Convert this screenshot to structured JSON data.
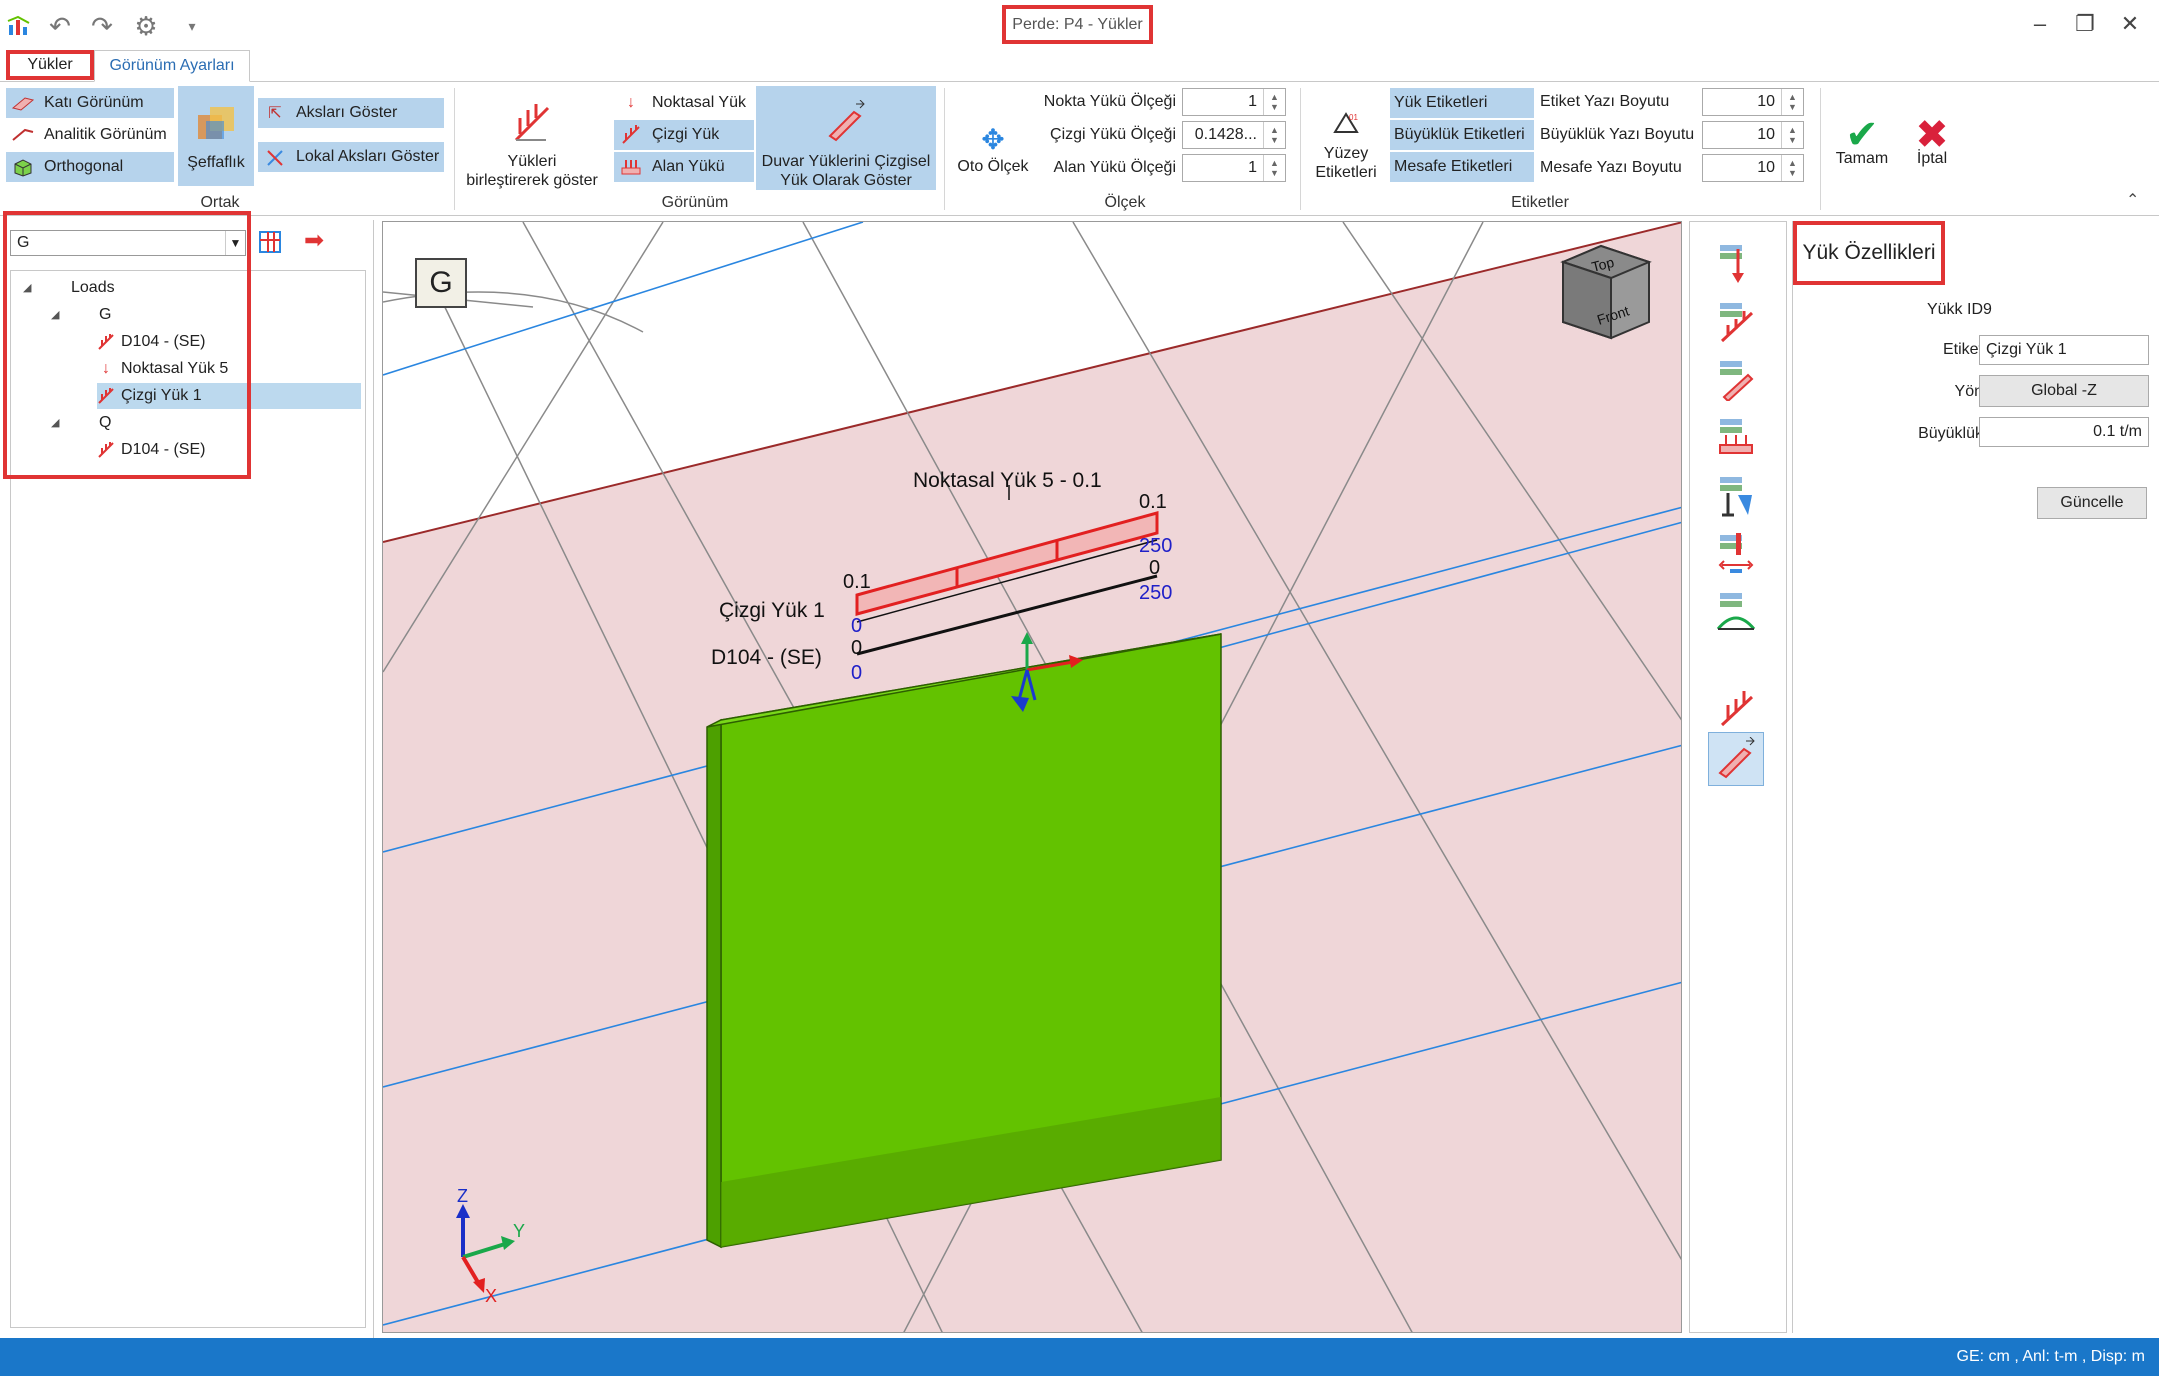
{
  "window": {
    "title": "Perde: P4 - Yükler",
    "minimize": "–",
    "restore": "❐",
    "close": "✕"
  },
  "quick_access": {
    "app_icon": "chart-icon",
    "undo": "↶",
    "redo": "↷",
    "settings": "⚙",
    "more": "▾"
  },
  "tabs": [
    "Yükler",
    "Görünüm Ayarları"
  ],
  "ribbon": {
    "ortak": {
      "label": "Ortak",
      "kati": "Katı Görünüm",
      "analitik": "Analitik Görünüm",
      "orthogonal": "Orthogonal",
      "seffaflik": "Şeffaflık",
      "akslari": "Aksları Göster",
      "lokal": "Lokal Aksları Göster"
    },
    "gorunum": {
      "label": "Görünüm",
      "birlestir": [
        "Yükleri",
        "birleştirerek göster"
      ],
      "noktasal": "Noktasal Yük",
      "cizgi": "Çizgi Yük",
      "alan": "Alan Yükü",
      "duvar": [
        "Duvar Yüklerini Çizgisel",
        "Yük Olarak Göster"
      ]
    },
    "olcek": {
      "label": "Ölçek",
      "oto": "Oto Ölçek",
      "nokta_lbl": "Nokta Yükü Ölçeği",
      "nokta_val": "1",
      "cizgi_lbl": "Çizgi Yükü Ölçeği",
      "cizgi_val": "0.1428...",
      "alan_lbl": "Alan Yükü Ölçeği",
      "alan_val": "1"
    },
    "etiketler": {
      "label": "Etiketler",
      "yuzey": [
        "Yüzey",
        "Etiketleri"
      ],
      "yuk_et": "Yük Etiketleri",
      "buyukluk_et": "Büyüklük Etiketleri",
      "mesafe_et": "Mesafe Etiketleri",
      "etiket_boyut_lbl": "Etiket Yazı Boyutu",
      "etiket_boyut_val": "10",
      "buyukluk_boyut_lbl": "Büyüklük Yazı Boyutu",
      "buyukluk_boyut_val": "10",
      "mesafe_boyut_lbl": "Mesafe Yazı Boyutu",
      "mesafe_boyut_val": "10"
    },
    "tamam": "Tamam",
    "iptal": "İptal"
  },
  "left": {
    "select_value": "G",
    "tree": {
      "root": "Loads",
      "g": "G",
      "g_items": [
        "D104 - (SE)",
        "Noktasal Yük 5",
        "Çizgi Yük 1"
      ],
      "q": "Q",
      "q_items": [
        "D104 - (SE)"
      ]
    }
  },
  "viewport": {
    "case_label": "G",
    "cube_top": "Top",
    "cube_front": "Front",
    "noktasal_label": "Noktasal Yük 5 - 0.1",
    "cizgi_label": "Çizgi Yük 1",
    "d104_label": "D104 - (SE)",
    "val_01_left": "0.1",
    "val_01_right": "0.1",
    "val_0_left": "0",
    "val_250_top": "250",
    "val_0_right": "0",
    "val_250_bottom": "250",
    "val_0_d104": "0",
    "val_0_d104_blue": "0",
    "axis_z": "Z",
    "axis_y": "Y",
    "axis_x": "X",
    "colors": {
      "wall": "#63c200",
      "slab": "#efd6d8",
      "grid_blue": "#2a86e0",
      "load_red": "#e22020",
      "dim_blue": "#2020c8"
    }
  },
  "props": {
    "title": "Yük Özellikleri",
    "id_lbl": "Yükk ID",
    "id_val": "9",
    "etiket_lbl": "Etiket",
    "etiket_val": "Çizgi Yük 1",
    "yon_lbl": "Yön",
    "yon_val": "Global -Z",
    "buyukluk_lbl": "Büyüklük",
    "buyukluk_val": "0.1 t/m",
    "update": "Güncelle"
  },
  "status": "GE: cm , Anl: t-m , Disp: m"
}
